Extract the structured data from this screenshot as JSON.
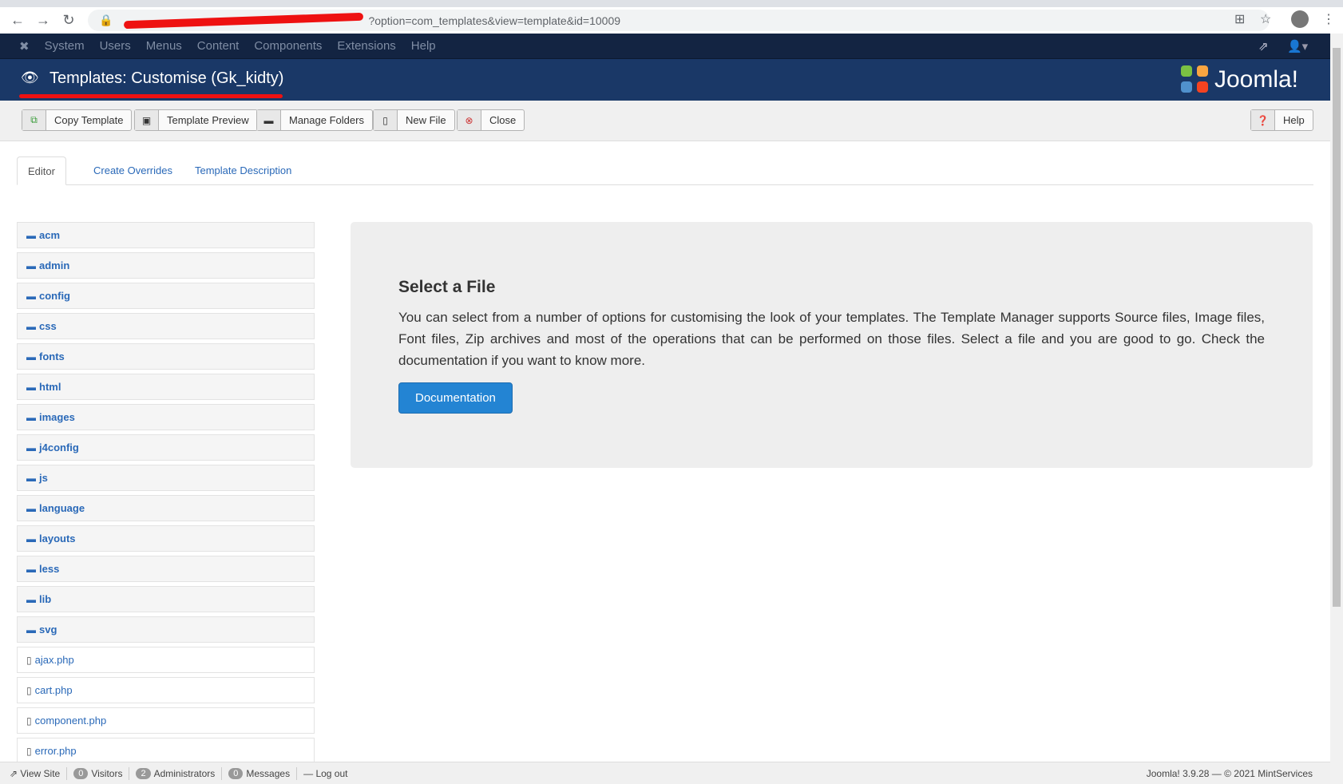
{
  "browser": {
    "url_visible": "?option=com_templates&view=template&id=10009"
  },
  "nav": {
    "items": [
      "System",
      "Users",
      "Menus",
      "Content",
      "Components",
      "Extensions",
      "Help"
    ]
  },
  "header": {
    "title": "Templates: Customise (Gk_kidty)",
    "logo": "Joomla!"
  },
  "toolbar": {
    "copy": "Copy Template",
    "preview": "Template Preview",
    "folders": "Manage Folders",
    "newfile": "New File",
    "close": "Close",
    "help": "Help"
  },
  "tabs": [
    "Editor",
    "Create Overrides",
    "Template Description"
  ],
  "tree": {
    "folders": [
      "acm",
      "admin",
      "config",
      "css",
      "fonts",
      "html",
      "images",
      "j4config",
      "js",
      "language",
      "layouts",
      "less",
      "lib",
      "svg"
    ],
    "files": [
      "ajax.php",
      "cart.php",
      "component.php",
      "error.php"
    ]
  },
  "panel": {
    "title": "Select a File",
    "text": "You can select from a number of options for customising the look of your templates. The Template Manager supports Source files, Image files, Font files, Zip archives and most of the operations that can be performed on those files. Select a file and you are good to go. Check the documentation if you want to know more.",
    "button": "Documentation"
  },
  "footer": {
    "view_site": "View Site",
    "visitors_count": "0",
    "visitors": "Visitors",
    "admins_count": "2",
    "admins": "Administrators",
    "messages_count": "0",
    "messages": "Messages",
    "logout": "Log out",
    "version": "Joomla! 3.9.28 — © 2021 MintServices"
  }
}
